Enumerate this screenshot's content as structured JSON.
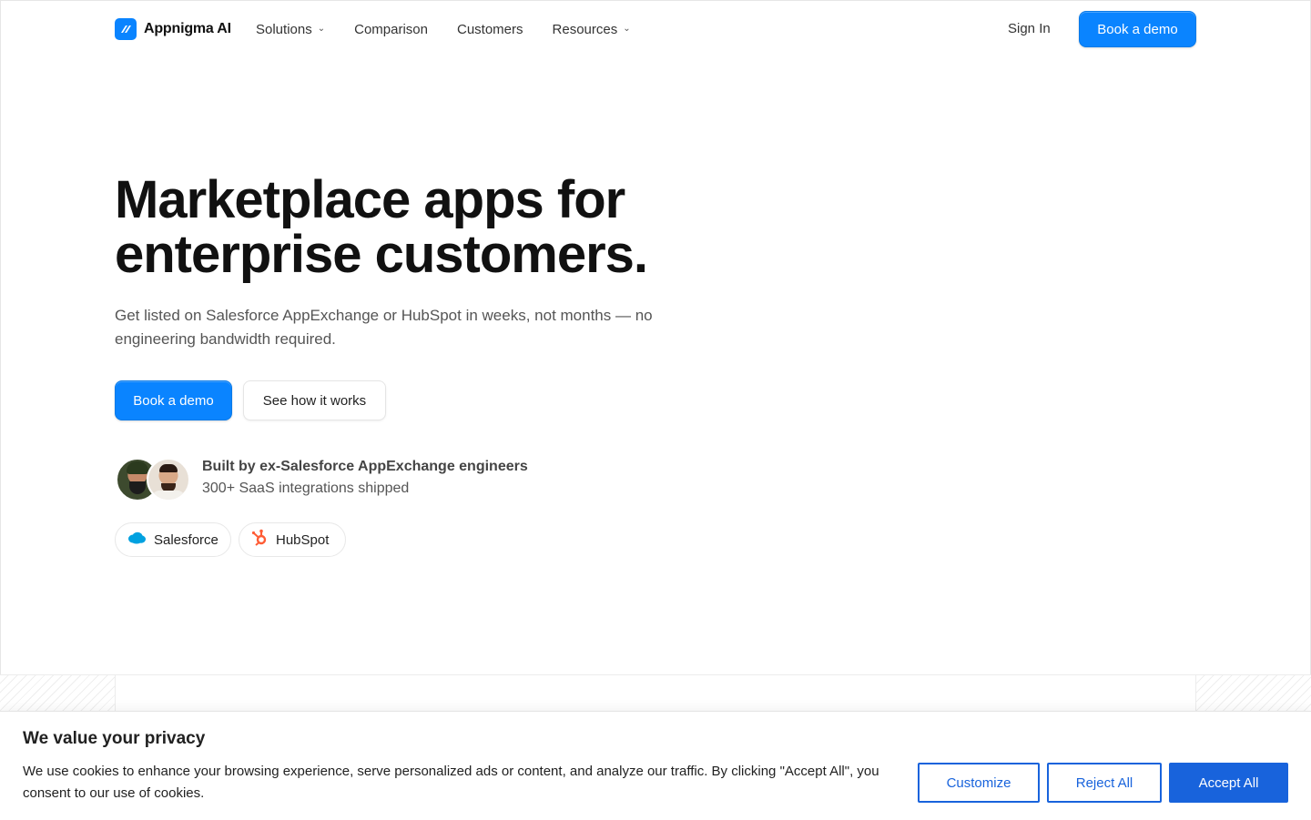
{
  "nav": {
    "brand": "Appnigma AI",
    "links": [
      {
        "label": "Solutions",
        "has_dropdown": true
      },
      {
        "label": "Comparison",
        "has_dropdown": false
      },
      {
        "label": "Customers",
        "has_dropdown": false
      },
      {
        "label": "Resources",
        "has_dropdown": true
      }
    ],
    "sign_in": "Sign In",
    "cta": "Book a demo"
  },
  "hero": {
    "headline_line1": "Marketplace apps for",
    "headline_line2": "enterprise customers.",
    "subhead": "Get listed on Salesforce AppExchange or HubSpot in weeks, not months — no engineering bandwidth required.",
    "primary_cta": "Book a demo",
    "secondary_cta": "See how it works",
    "credibility": {
      "title": "Built by ex-Salesforce AppExchange engineers",
      "subtitle": "300+ SaaS integrations shipped"
    },
    "platforms": [
      {
        "label": "Salesforce",
        "icon": "salesforce-cloud-icon"
      },
      {
        "label": "HubSpot",
        "icon": "hubspot-sprocket-icon"
      }
    ]
  },
  "cookie_banner": {
    "title": "We value your privacy",
    "text": "We use cookies to enhance your browsing experience, serve personalized ads or content, and analyze our traffic. By clicking \"Accept All\", you consent to our use of cookies.",
    "customize": "Customize",
    "reject": "Reject All",
    "accept": "Accept All"
  },
  "colors": {
    "accent": "#0a84ff",
    "cookie_accent": "#1863dc",
    "hubspot": "#ff5c35",
    "salesforce": "#00a1e0"
  }
}
